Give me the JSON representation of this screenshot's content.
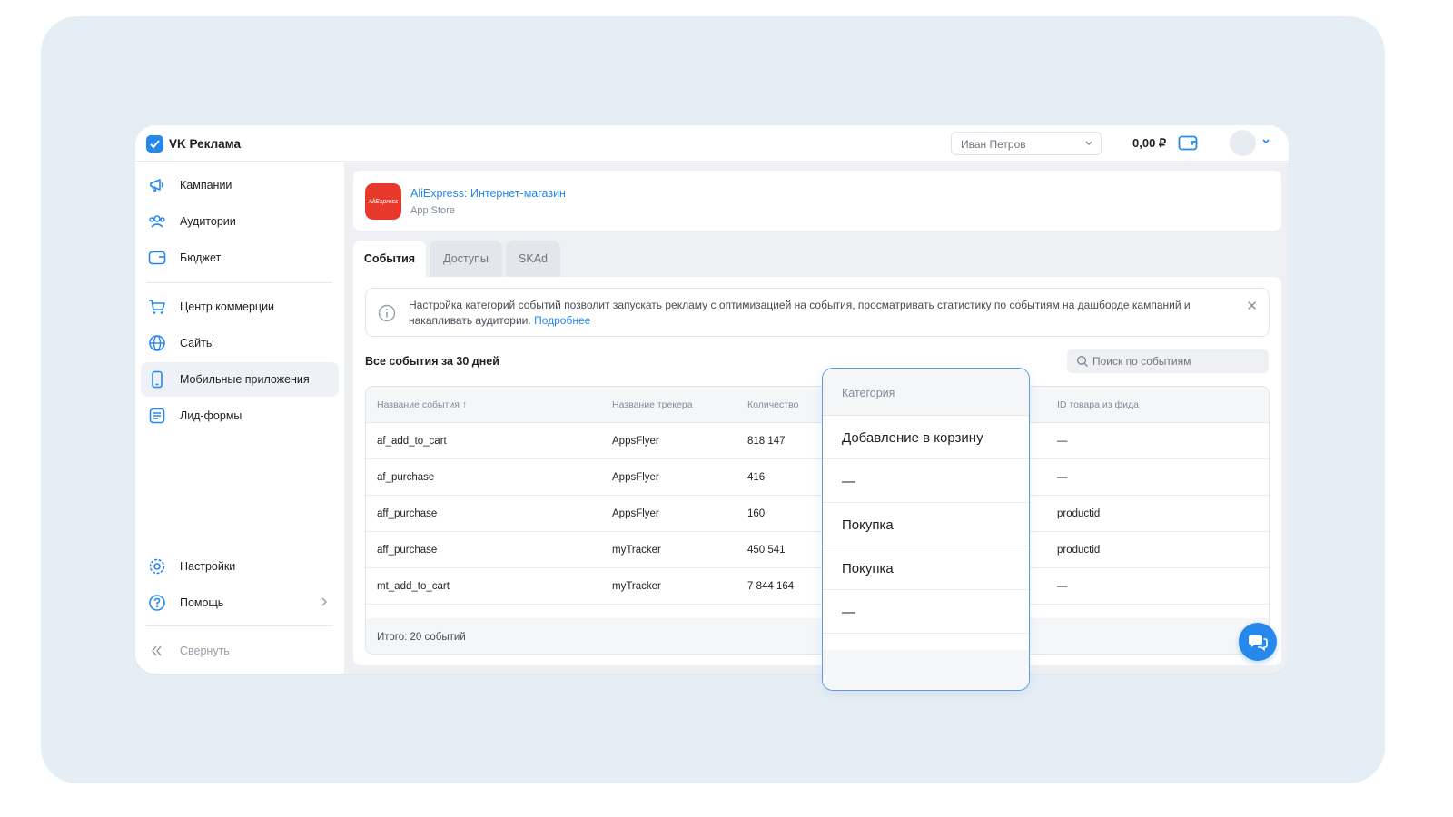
{
  "app": {
    "title": "VK Реклама"
  },
  "header": {
    "account": "Иван Петров",
    "balance": "0,00 ₽"
  },
  "sidebar": {
    "items": [
      {
        "label": "Кампании",
        "icon": "megaphone-icon"
      },
      {
        "label": "Аудитории",
        "icon": "users-icon"
      },
      {
        "label": "Бюджет",
        "icon": "wallet-icon"
      },
      {
        "label": "Центр коммерции",
        "icon": "cart-icon"
      },
      {
        "label": "Сайты",
        "icon": "globe-icon"
      },
      {
        "label": "Мобильные приложения",
        "icon": "phone-icon",
        "active": true
      },
      {
        "label": "Лид-формы",
        "icon": "form-icon"
      }
    ],
    "bottom": [
      {
        "label": "Настройки",
        "icon": "gear-icon"
      },
      {
        "label": "Помощь",
        "icon": "help-icon"
      }
    ],
    "collapse": "Свернуть"
  },
  "app_card": {
    "name": "AliExpress: Интернет-магазин",
    "store": "App Store",
    "icon_text": "AliExpress"
  },
  "tabs": [
    "События",
    "Доступы",
    "SKAd"
  ],
  "info": {
    "text": "Настройка категорий событий позволит запускать рекламу с оптимизацией на события, просматривать статистику по событиям на дашборде кампаний и накапливать аудитории.",
    "link": "Подробнее"
  },
  "events": {
    "title": "Все события за 30 дней",
    "search_placeholder": "Поиск по событиям",
    "columns": [
      "Название события ↑",
      "Название трекера",
      "Количество",
      "ID товара из фида"
    ],
    "rows": [
      [
        "af_add_to_cart",
        "AppsFlyer",
        "818 147",
        "—"
      ],
      [
        "af_purchase",
        "AppsFlyer",
        "416",
        "—"
      ],
      [
        "aff_purchase",
        "AppsFlyer",
        "160",
        "productid"
      ],
      [
        "aff_purchase",
        "myTracker",
        "450 541",
        "productid"
      ],
      [
        "mt_add_to_cart",
        "myTracker",
        "7 844 164",
        "—"
      ]
    ],
    "total": "Итого: 20 событий"
  },
  "category_panel": {
    "header": "Категория",
    "values": [
      "Добавление в корзину",
      "—",
      "Покупка",
      "Покупка",
      "—"
    ]
  },
  "colors": {
    "accent": "#2688eb",
    "backdrop": "#e6eef5",
    "app_icon": "#e8382b"
  }
}
